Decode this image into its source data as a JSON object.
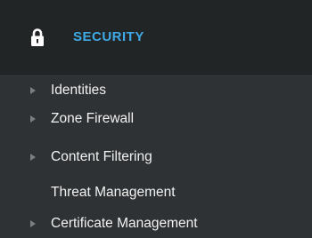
{
  "section": {
    "title": "SECURITY",
    "icon": "lock-icon",
    "accent_color": "#3fa9e6"
  },
  "nav": {
    "items": [
      {
        "label": "Identities",
        "expandable": true
      },
      {
        "label": "Zone Firewall",
        "expandable": true
      },
      {
        "label": "Content Filtering",
        "expandable": true
      },
      {
        "label": "Threat Management",
        "expandable": false
      },
      {
        "label": "Certificate Management",
        "expandable": true
      }
    ]
  }
}
